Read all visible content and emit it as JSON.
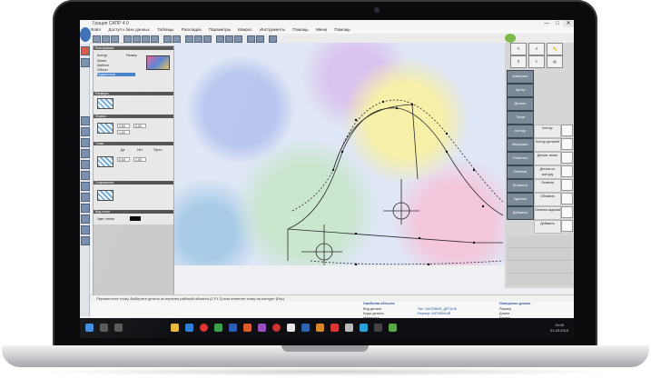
{
  "window": {
    "title": "Грация САПР 4.0",
    "controls": [
      "—",
      "□",
      "✕"
    ]
  },
  "menubar": [
    "Файл",
    "Доступ к базе данных",
    "Таблицы",
    "Раскладка",
    "Параметры",
    "Макрос",
    "Инструменты",
    "Помощь",
    "Меню",
    "Помощь"
  ],
  "left_panel": {
    "sections": [
      "Конструкция",
      "Размеры",
      "Формы",
      "Точки",
      "Сопряжения",
      "Вид сетки"
    ],
    "table": {
      "headers": [
        "Контур",
        "Размер"
      ],
      "rows": [
        "Линия",
        "Шаблон",
        "Объект",
        "Подсистема"
      ]
    },
    "fields": {
      "a": "1.00",
      "b": "0.00",
      "c": "1.00",
      "d": "0.00",
      "e": "1.00"
    },
    "options": [
      "Да",
      "Нет",
      "Пусто"
    ],
    "bottom_label": "Цвет линии"
  },
  "canvas": {
    "desc_note": ""
  },
  "right_panel": {
    "buttons": [
      "Измерить",
      "Центр",
      "Детали",
      "Точки",
      "Контур",
      "Вырезать",
      "Отметить",
      "Отметки",
      "Вставить",
      "Удалить",
      "Добавить"
    ],
    "labels": [
      "Контур",
      "Контур деталей",
      "Деталь линии",
      "Деталь по контуру",
      "Отметки",
      "Обновить",
      "Отметка изделия",
      "Добавить"
    ]
  },
  "status": {
    "message": "Переместите точку. Выберите деталь из перечня рабочей области (1 F1 2) или отметьте точку на контуре (Esc).",
    "info_left": [
      "Вид детали",
      "Коды детали",
      "Материал"
    ],
    "info_mid_title": "Свойства объекта",
    "info_mid": [
      "Тип: БАЗОВАЯ_ДЕТАЛЬ",
      "Размер: АКТИВНЫЙ"
    ],
    "info_right_title": "Измерение длины",
    "info_right": [
      "Размер",
      "Длина",
      "Контур"
    ]
  },
  "taskbar": {
    "time": "13:45",
    "date": "21.03.2019"
  },
  "colors": {
    "accent": "#4d5d72",
    "section": "#4d4d4d",
    "taskbar": "#0d0f12"
  }
}
